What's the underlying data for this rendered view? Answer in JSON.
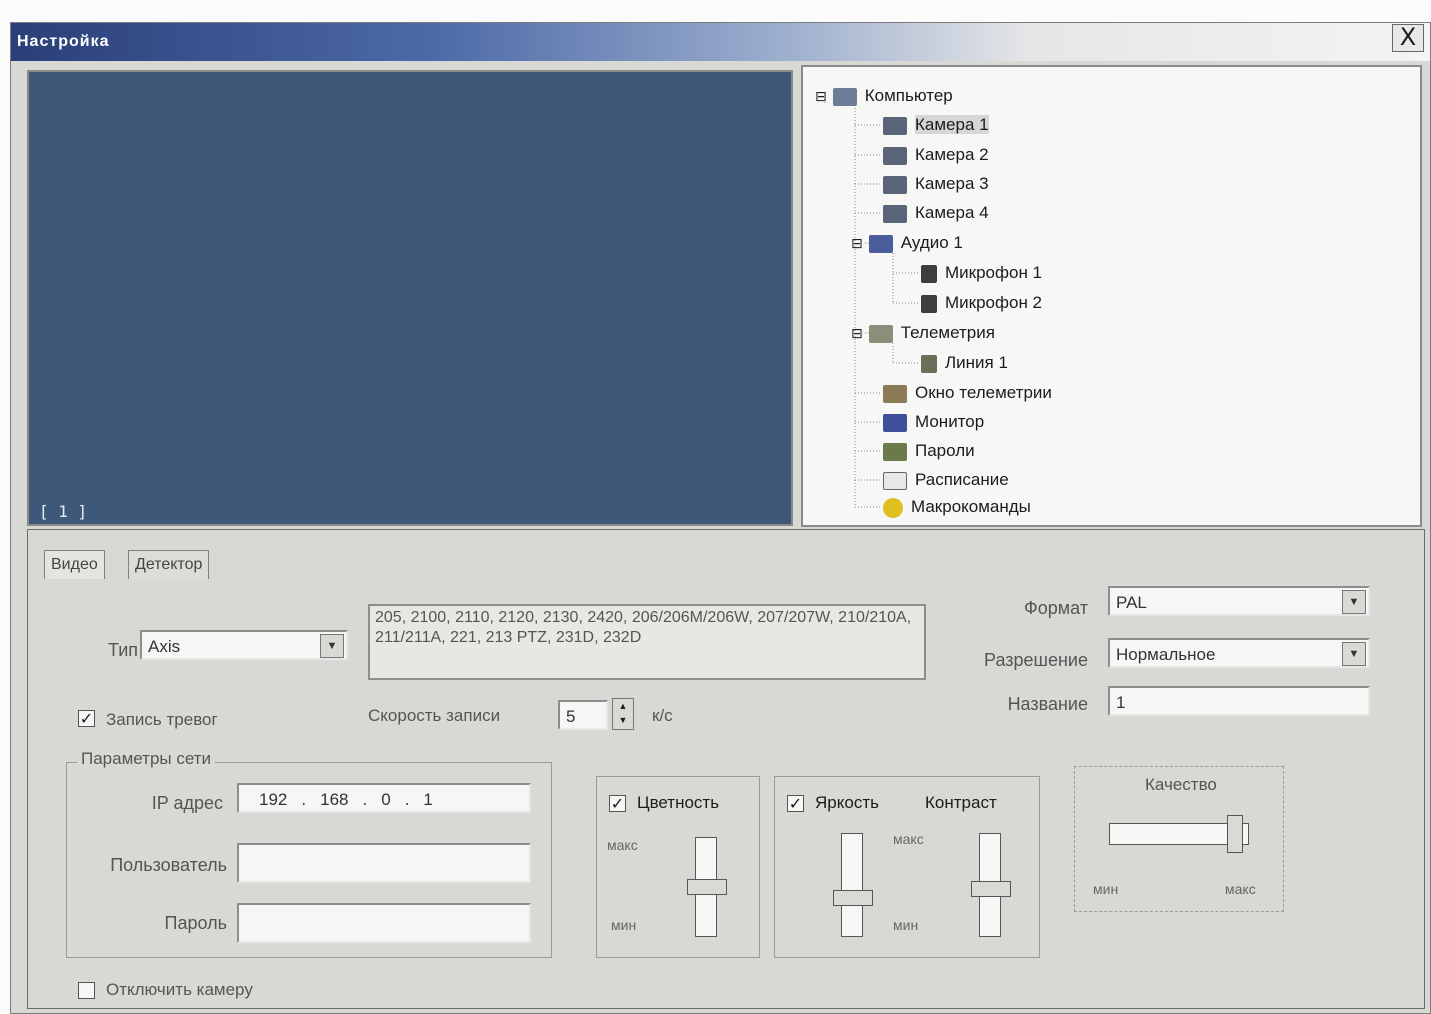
{
  "window": {
    "title": "Настройка",
    "close_label": "X"
  },
  "video": {
    "overlay_label": "[ 1 ]"
  },
  "tree": {
    "items": [
      {
        "label": "Компьютер",
        "icon": "computer-icon",
        "expander": "⊟"
      },
      {
        "label": "Камера 1",
        "icon": "camera-icon",
        "selected": true
      },
      {
        "label": "Камера 2",
        "icon": "camera-icon"
      },
      {
        "label": "Камера 3",
        "icon": "camera-icon"
      },
      {
        "label": "Камера 4",
        "icon": "camera-icon"
      },
      {
        "label": "Аудио 1",
        "icon": "audio-card-icon",
        "expander": "⊟"
      },
      {
        "label": "Микрофон 1",
        "icon": "microphone-icon"
      },
      {
        "label": "Микрофон 2",
        "icon": "microphone-icon"
      },
      {
        "label": "Телеметрия",
        "icon": "telemetry-icon",
        "expander": "⊟"
      },
      {
        "label": "Линия 1",
        "icon": "line-icon"
      },
      {
        "label": "Окно телеметрии",
        "icon": "telemetry-window-icon"
      },
      {
        "label": "Монитор",
        "icon": "monitor-icon"
      },
      {
        "label": "Пароли",
        "icon": "passwords-icon"
      },
      {
        "label": "Расписание",
        "icon": "schedule-icon"
      },
      {
        "label": "Макрокоманды",
        "icon": "macro-icon"
      }
    ]
  },
  "tabs": [
    {
      "label": "Видео",
      "active": true
    },
    {
      "label": "Детектор",
      "active": false
    }
  ],
  "type": {
    "label": "Тип",
    "value": "Axis"
  },
  "models_text": "205, 2100, 2110, 2120, 2130, 2420, 206/206M/206W, 207/207W, 210/210A, 211/211A, 221, 213 PTZ, 231D, 232D",
  "alarm_record": {
    "label": "Запись тревог",
    "checked": true
  },
  "record_speed": {
    "label": "Скорость записи",
    "value": "5",
    "unit": "к/с"
  },
  "format": {
    "label": "Формат",
    "value": "PAL"
  },
  "resolution": {
    "label": "Разрешение",
    "value": "Нормальное"
  },
  "name": {
    "label": "Название",
    "value": "1"
  },
  "network": {
    "group_label": "Параметры сети",
    "ip_label": "IP адрес",
    "ip": [
      "192",
      "168",
      "0",
      "1"
    ],
    "user_label": "Пользователь",
    "user_value": "",
    "password_label": "Пароль",
    "password_value": ""
  },
  "color": {
    "label": "Цветность",
    "checked": true,
    "max_label": "макс",
    "min_label": "мин",
    "level": 0.5
  },
  "brightness": {
    "label": "Яркость",
    "checked": true,
    "level": 0.35
  },
  "contrast": {
    "label": "Контраст",
    "max_label": "макс",
    "min_label": "мин",
    "level": 0.45
  },
  "quality": {
    "label": "Качество",
    "min_label": "мин",
    "max_label": "макс",
    "level": 0.95
  },
  "disable_camera": {
    "label": "Отключить камеру",
    "checked": false
  },
  "colors": {
    "video_bg": "#3f5778",
    "title_start": "#2a3f78"
  }
}
